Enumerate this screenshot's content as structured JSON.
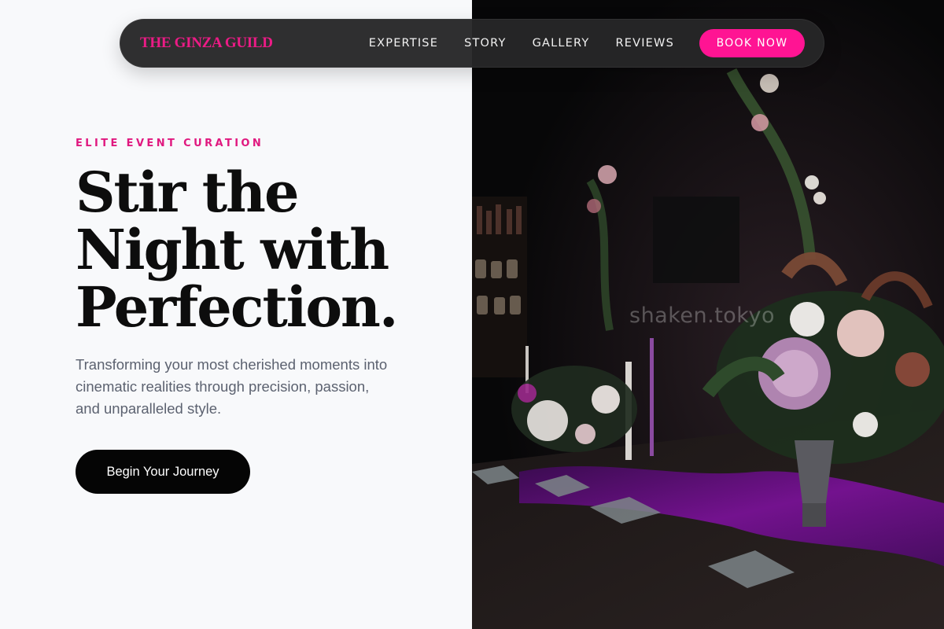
{
  "nav": {
    "brand": "THE GINZA GUILD",
    "links": [
      "EXPERTISE",
      "STORY",
      "GALLERY",
      "REVIEWS"
    ],
    "cta": "BOOK NOW"
  },
  "hero": {
    "eyebrow": "ELITE EVENT CURATION",
    "headline_lines": [
      "Stir the",
      "Night with",
      "Perfection."
    ],
    "subtext": "Transforming your most cherished moments into cinematic realities through precision, passion, and unparalleled style.",
    "cta": "Begin Your Journey"
  },
  "image": {
    "watermark": "shaken.tokyo"
  },
  "colors": {
    "accent": "#ff1493",
    "brand": "#ec1b86",
    "nav_bg": "#262628",
    "headline": "#0d0d0d",
    "body_text": "#5c6270"
  }
}
